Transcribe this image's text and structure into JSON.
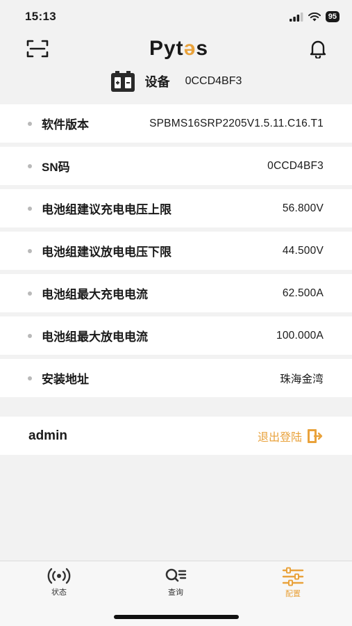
{
  "status_bar": {
    "time": "15:13",
    "battery": "95"
  },
  "header": {
    "logo_prefix": "Pyt",
    "logo_mark": "ǝ",
    "logo_suffix": "s"
  },
  "device": {
    "label": "设备",
    "id": "0CCD4BF3"
  },
  "info_rows": [
    {
      "label": "软件版本",
      "value": "SPBMS16SRP2205V1.5.11.C16.T1"
    },
    {
      "label": "SN码",
      "value": "0CCD4BF3"
    },
    {
      "label": "电池组建议充电电压上限",
      "value": "56.800V"
    },
    {
      "label": "电池组建议放电电压下限",
      "value": "44.500V"
    },
    {
      "label": "电池组最大充电电流",
      "value": "62.500A"
    },
    {
      "label": "电池组最大放电电流",
      "value": "100.000A"
    },
    {
      "label": "安装地址",
      "value": "珠海金湾"
    }
  ],
  "account": {
    "username": "admin",
    "logout_label": "退出登陆"
  },
  "tabs": [
    {
      "label": "状态",
      "icon": "signal-icon"
    },
    {
      "label": "查询",
      "icon": "search-list-icon"
    },
    {
      "label": "配置",
      "icon": "sliders-icon"
    }
  ],
  "colors": {
    "accent": "#e9a23b",
    "background": "#f2f2f2"
  }
}
